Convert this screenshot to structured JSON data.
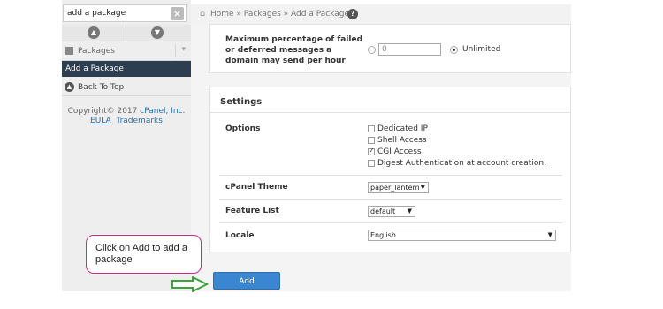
{
  "sidebar": {
    "search_value": "add a package",
    "clear_symbol": "×",
    "nav_up_symbol": "▲",
    "nav_down_symbol": "▼",
    "packages_label": "Packages",
    "active_item_label": "Add a Package",
    "back_to_top_label": "Back To Top",
    "copyright_prefix": "Copyright© 2017",
    "copyright_link": "cPanel, Inc.",
    "eula_link": "EULA",
    "trademarks_link": "Trademarks"
  },
  "breadcrumb": {
    "text": "Home » Packages » Add a Package",
    "help_symbol": "?"
  },
  "max_rate": {
    "label": "Maximum percentage of failed or deferred messages a domain may send per hour",
    "input_value": "0",
    "unlimited_label": "Unlimited",
    "selected": "unlimited"
  },
  "settings": {
    "title": "Settings",
    "options_label": "Options",
    "options": [
      {
        "label": "Dedicated IP",
        "checked": false
      },
      {
        "label": "Shell Access",
        "checked": false
      },
      {
        "label": "CGI Access",
        "checked": true
      },
      {
        "label": "Digest Authentication at account creation.",
        "checked": false
      }
    ],
    "theme_label": "cPanel Theme",
    "theme_value": "paper_lantern",
    "feature_list_label": "Feature List",
    "feature_list_value": "default",
    "locale_label": "Locale",
    "locale_value": "English"
  },
  "actions": {
    "add_label": "Add"
  },
  "callout": {
    "text": "Click on Add to add a package"
  },
  "colors": {
    "sidebar_active": "#2d3e50",
    "button": "#3b86d0",
    "callout_border": "#d12a8a",
    "arrow": "#3aa33a"
  }
}
